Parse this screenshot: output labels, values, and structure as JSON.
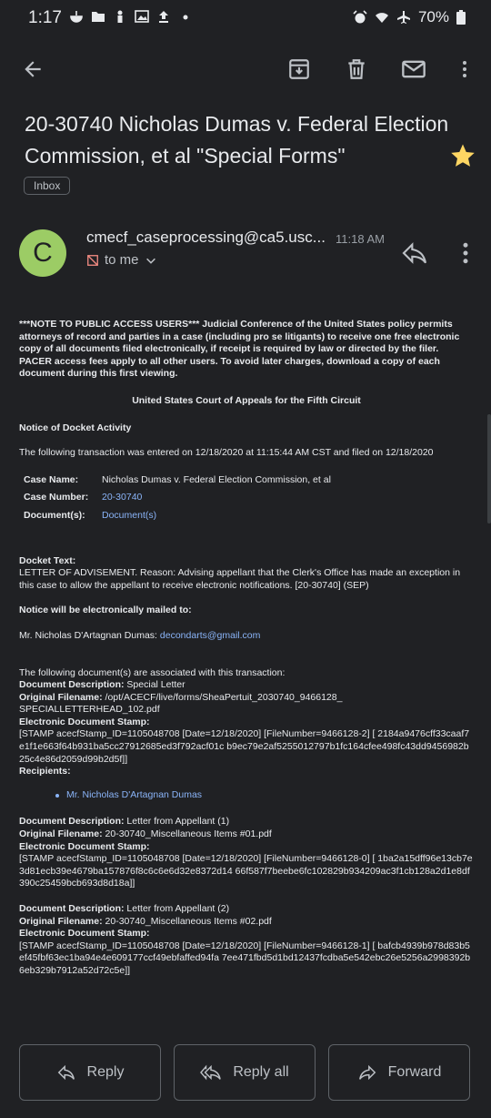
{
  "status_bar": {
    "time": "1:17",
    "battery": "70%"
  },
  "email": {
    "subject": "20-30740 Nicholas Dumas v. Federal Election Commission, et al \"Special Forms\"",
    "label_chip": "Inbox",
    "avatar_letter": "C",
    "sender": "cmecf_caseprocessing@ca5.usc...",
    "time": "11:18 AM",
    "recipient": "to me"
  },
  "body": {
    "notice_bold": "***NOTE TO PUBLIC ACCESS USERS*** Judicial Conference of the United States policy permits attorneys of record and parties in a case (including pro se litigants) to receive one free electronic copy of all documents filed electronically, if receipt is required by law or directed by the filer. PACER access fees apply to all other users. To avoid later charges, download a copy of each document during this first viewing.",
    "court": "United States Court of Appeals for the Fifth Circuit",
    "docket_activity_heading": "Notice of Docket Activity",
    "transaction_text": "The following transaction was entered on 12/18/2020 at 11:15:44 AM CST and filed on 12/18/2020",
    "case_name_label": "Case Name:",
    "case_name": "Nicholas Dumas v. Federal Election Commission, et al",
    "case_number_label": "Case Number:",
    "case_number": "20-30740",
    "documents_label": "Document(s):",
    "documents": "Document(s)",
    "docket_text_label": "Docket Text:",
    "docket_text": "LETTER OF ADVISEMENT. Reason: Advising appellant that the Clerk's Office has made an exception in this case to allow the appellant to receive electronic notifications. [20-30740] (SEP)",
    "mailed_heading": "Notice will be electronically mailed to:",
    "mailed_name": "Mr. Nicholas D'Artagnan Dumas: ",
    "mailed_email": "decondarts@gmail.com",
    "associated_text": "The following document(s) are associated with this transaction:",
    "desc_label": "Document Description:",
    "orig_label": "Original Filename:",
    "stamp_label": "Electronic Document Stamp:",
    "recipients_label": "Recipients:",
    "recipient_link": "Mr. Nicholas D'Artagnan Dumas",
    "doc1": {
      "description": " Special Letter",
      "filename": " /opt/ACECF/live/forms/SheaPertuit_2030740_9466128_ SPECIALLETTERHEAD_102.pdf",
      "stamp": "[STAMP acecfStamp_ID=1105048708 [Date=12/18/2020] [FileNumber=9466128-2] [ 2184a9476cff33caaf7e1f1e663f64b931ba5cc27912685ed3f792acf01c b9ec79e2af5255012797b1fc164cfee498fc43dd9456982b25c4e86d2059d99b2d5f]]"
    },
    "doc2": {
      "description": " Letter from Appellant (1)",
      "filename": " 20-30740_Miscellaneous Items #01.pdf",
      "stamp": "[STAMP acecfStamp_ID=1105048708 [Date=12/18/2020] [FileNumber=9466128-0] [ 1ba2a15dff96e13cb7e3d81ecb39e4679ba157876f8c6c6e6d32e8372d14 66f587f7beebe6fc102829b934209ac3f1cb128a2d1e8df390c25459bcb693d8d18a]]"
    },
    "doc3": {
      "description": " Letter from Appellant (2)",
      "filename": " 20-30740_Miscellaneous Items #02.pdf",
      "stamp": "[STAMP acecfStamp_ID=1105048708 [Date=12/18/2020] [FileNumber=9466128-1] [ bafcb4939b978d83b5ef45fbf63ec1ba94e4e609177ccf49ebfaffed94fa 7ee471fbd5d1bd12437fcdba5e542ebc26e5256a2998392b6eb329b7912a52d72c5e]]"
    }
  },
  "actions": {
    "reply": "Reply",
    "reply_all": "Reply all",
    "forward": "Forward"
  },
  "colors": {
    "background": "#202124",
    "link": "#8ab4f8",
    "star": "#fdd663",
    "avatar": "#9ccc65"
  }
}
